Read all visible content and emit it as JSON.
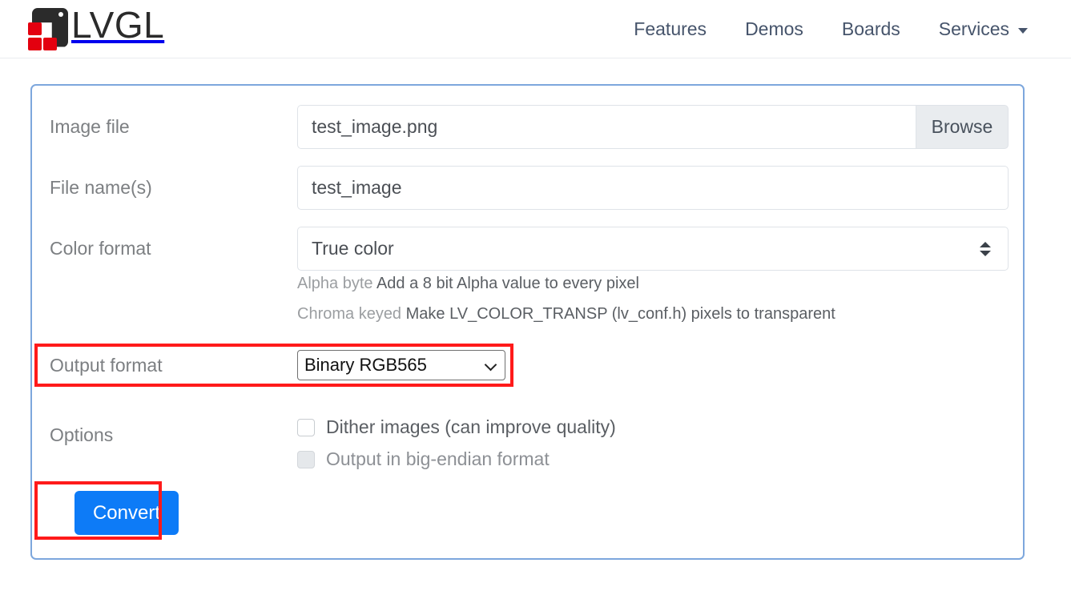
{
  "header": {
    "brand_text": "LVGL",
    "brand_icon": "lvgl-logo-icon",
    "nav": [
      {
        "label": "Features",
        "name": "nav-link-features"
      },
      {
        "label": "Demos",
        "name": "nav-link-demos"
      },
      {
        "label": "Boards",
        "name": "nav-link-boards"
      },
      {
        "label": "Services",
        "name": "nav-link-services",
        "has_caret": true
      }
    ]
  },
  "form": {
    "image_file": {
      "label": "Image file",
      "value": "test_image.png",
      "placeholder": "",
      "browse_label": "Browse"
    },
    "file_names": {
      "label": "File name(s)",
      "value": "test_image",
      "placeholder": ""
    },
    "color_format": {
      "label": "Color format",
      "value": "True color",
      "help": [
        {
          "key": "Alpha byte",
          "value": "Add a 8 bit Alpha value to every pixel"
        },
        {
          "key": "Chroma keyed",
          "value": "Make LV_COLOR_TRANSP (lv_conf.h) pixels to transparent"
        }
      ]
    },
    "output_format": {
      "label": "Output format",
      "value": "Binary RGB565"
    },
    "options": {
      "label": "Options",
      "items": [
        {
          "label": "Dither images (can improve quality)",
          "checked": false,
          "disabled": false
        },
        {
          "label": "Output in big-endian format",
          "checked": false,
          "disabled": true
        }
      ]
    },
    "convert": {
      "label": "Convert"
    }
  },
  "colors": {
    "brand_dark": "#2b2b2b",
    "brand_red": "#e3000f",
    "card_border": "#7da7dd",
    "annotation_red": "#ff1a1a",
    "primary_button": "#0d7bf7",
    "nav_text": "#46546b"
  }
}
